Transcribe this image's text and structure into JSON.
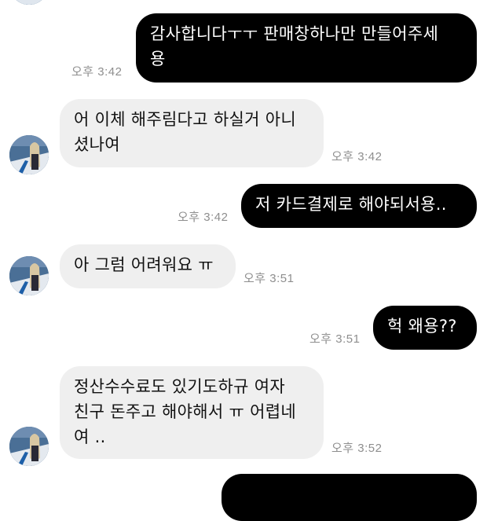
{
  "colors": {
    "outgoing_bubble": "#000000",
    "incoming_bubble": "#efefef",
    "timestamp": "#8e8e8e"
  },
  "messages": [
    {
      "side": "outgoing",
      "text": "감사합니다ㅜㅜ 판매창하나만 만들어주세\n용",
      "time": "오후 3:42"
    },
    {
      "side": "incoming",
      "text": "어 이체 해주림다고 하실거 아니\n셨나여",
      "time": "오후 3:42",
      "avatar": "profile-avatar"
    },
    {
      "side": "outgoing",
      "text": "저 카드결제로 해야되서용..",
      "time": "오후 3:42"
    },
    {
      "side": "incoming",
      "text": "아 그럼 어려워요 ㅠ",
      "time": "오후 3:51",
      "avatar": "profile-avatar"
    },
    {
      "side": "outgoing",
      "text": "헉 왜용??",
      "time": "오후 3:51"
    },
    {
      "side": "incoming",
      "text": "정산수수료도 있기도하규 여자\n친구 돈주고 해야해서 ㅠ 어렵네\n여 ..",
      "time": "오후 3:52",
      "avatar": "profile-avatar"
    },
    {
      "side": "outgoing",
      "text": "",
      "time": ""
    }
  ]
}
